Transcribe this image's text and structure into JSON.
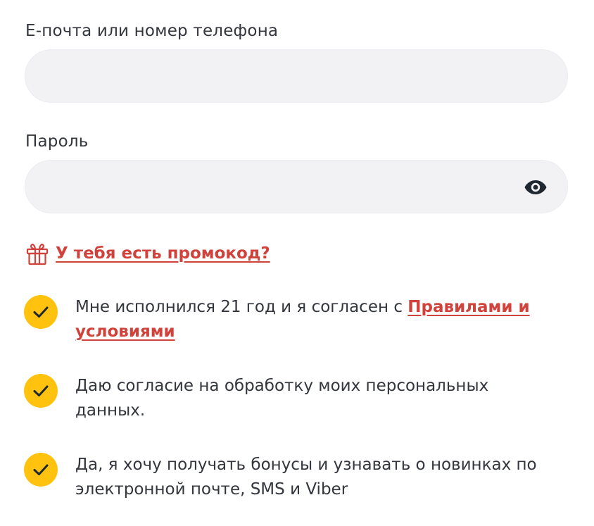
{
  "email": {
    "label": "Е-почта или номер телефона",
    "value": "",
    "placeholder": ""
  },
  "password": {
    "label": "Пароль",
    "value": "",
    "placeholder": "",
    "toggle_icon": "eye-icon"
  },
  "promo": {
    "icon": "gift-icon",
    "link_text": "У тебя есть промокод?"
  },
  "consents": [
    {
      "checked": true,
      "text_before": "Мне исполнился 21 год и я согласен с ",
      "link_text": "Правилами и условиями"
    },
    {
      "checked": true,
      "text": "Даю согласие на обработку моих персональных данных."
    },
    {
      "checked": true,
      "text": "Да, я хочу получать бонусы и узнавать о новинках по электронной почте, SMS и Viber"
    }
  ],
  "colors": {
    "accent_link": "#d0423c",
    "checkbox": "#ffc20e",
    "field_bg": "#f2f2f5",
    "text": "#33363d"
  }
}
